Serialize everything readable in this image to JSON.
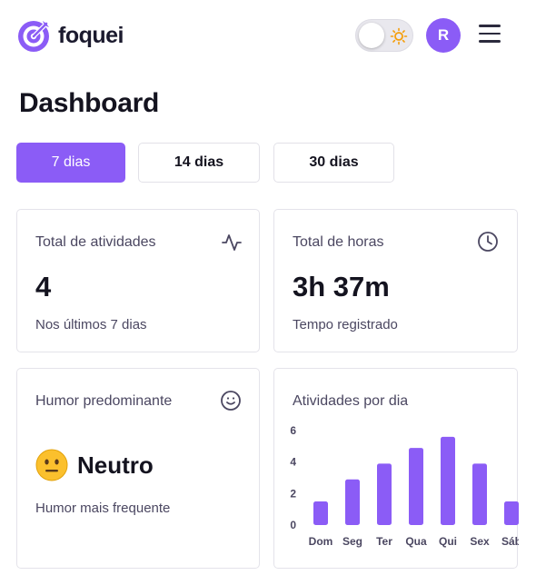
{
  "app": {
    "name": "foquei"
  },
  "header": {
    "avatar_initial": "R",
    "accent_color": "#8b5cf6"
  },
  "page": {
    "title": "Dashboard"
  },
  "tabs": [
    {
      "label": "7 dias",
      "active": true
    },
    {
      "label": "14 dias",
      "active": false
    },
    {
      "label": "30 dias",
      "active": false
    }
  ],
  "cards": {
    "atividades": {
      "title": "Total de atividades",
      "value": "4",
      "subtitle": "Nos últimos 7 dias",
      "icon": "activity-pulse-icon"
    },
    "horas": {
      "title": "Total de horas",
      "value": "3h 37m",
      "subtitle": "Tempo registrado",
      "icon": "clock-icon"
    },
    "humor": {
      "title": "Humor predominante",
      "emoji": "neutral-face",
      "value": "Neutro",
      "subtitle": "Humor mais frequente",
      "icon": "smile-icon"
    },
    "chart": {
      "title": "Atividades por dia"
    }
  },
  "chart_data": {
    "type": "bar",
    "title": "Atividades por dia",
    "categories": [
      "Dom",
      "Seg",
      "Ter",
      "Qua",
      "Qui",
      "Sex",
      "Sáb"
    ],
    "values": [
      1.5,
      2.9,
      3.9,
      4.9,
      5.6,
      3.9,
      1.5
    ],
    "y_ticks": [
      "0",
      "2",
      "4",
      "6"
    ],
    "ylim": [
      0,
      6
    ],
    "bar_color": "#8b5cf6",
    "grid": false
  }
}
